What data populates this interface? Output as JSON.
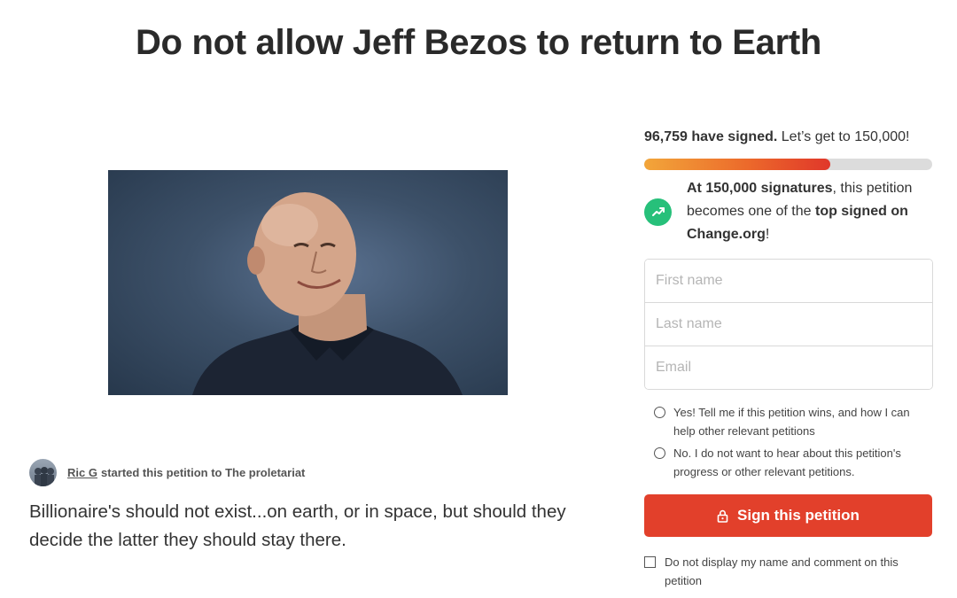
{
  "petition": {
    "title": "Do not allow Jeff Bezos to return to Earth",
    "starter_name": "Ric G",
    "starter_text": "started this petition to The proletariat",
    "description": "Billionaire's should not exist...on earth, or in space, but should they decide the latter they should stay there."
  },
  "signatures": {
    "count_text": "96,759 have signed.",
    "goal_text": "Let’s get to 150,000!",
    "progress_percent": 64.5,
    "milestone_bold_1": "At 150,000 signatures",
    "milestone_text_1": ", this petition becomes one of the ",
    "milestone_bold_2": "top signed on Change.org",
    "milestone_text_2": "!"
  },
  "form": {
    "first_name_placeholder": "First name",
    "last_name_placeholder": "Last name",
    "email_placeholder": "Email",
    "option_yes": "Yes! Tell me if this petition wins, and how I can help other relevant petitions",
    "option_no": "No. I do not want to hear about this petition's progress or other relevant petitions.",
    "sign_button": "Sign this petition",
    "hide_name_label": "Do not display my name and comment on this petition"
  },
  "colors": {
    "accent_red": "#e2402b",
    "milestone_green": "#27c07a"
  },
  "icons": {
    "milestone": "trending-up-icon",
    "button": "lock-icon"
  }
}
